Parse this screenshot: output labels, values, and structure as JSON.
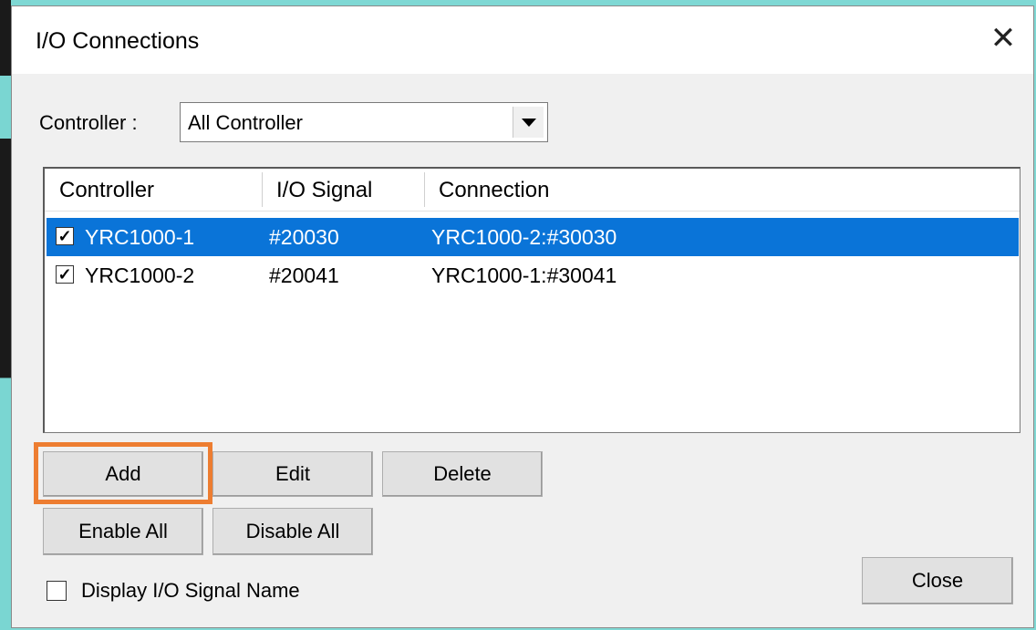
{
  "window": {
    "title": "I/O Connections",
    "close_glyph": "✕"
  },
  "filter": {
    "label": "Controller :",
    "selected": "All Controller"
  },
  "table": {
    "columns": [
      "Controller",
      "I/O Signal",
      "Connection"
    ],
    "rows": [
      {
        "checked": true,
        "controller": "YRC1000-1",
        "signal": "#20030",
        "connection": "YRC1000-2:#30030",
        "selected": true
      },
      {
        "checked": true,
        "controller": "YRC1000-2",
        "signal": "#20041",
        "connection": "YRC1000-1:#30041",
        "selected": false
      }
    ]
  },
  "buttons": {
    "add": "Add",
    "edit": "Edit",
    "delete": "Delete",
    "enable_all": "Enable All",
    "disable_all": "Disable All",
    "close": "Close"
  },
  "options": {
    "display_signal_name_label": "Display I/O Signal Name",
    "display_signal_name_checked": false
  },
  "colors": {
    "selection": "#0a74d8",
    "highlight": "#ed7d31"
  }
}
